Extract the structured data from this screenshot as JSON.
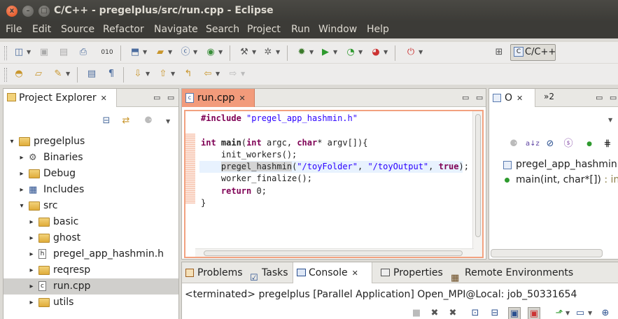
{
  "window": {
    "title": "C/C++ - pregelplus/src/run.cpp - Eclipse",
    "close_glyph": "x",
    "min_glyph": "–",
    "max_glyph": "□"
  },
  "menu": [
    "File",
    "Edit",
    "Source",
    "Refactor",
    "Navigate",
    "Search",
    "Project",
    "Run",
    "Window",
    "Help"
  ],
  "perspective": {
    "label": "C/C++"
  },
  "project_explorer": {
    "tab_label": "Project Explorer",
    "close": "✕",
    "items": [
      {
        "label": "pregelplus",
        "level": 0,
        "twisty": "▾",
        "icon": "project-icon"
      },
      {
        "label": "Binaries",
        "level": 1,
        "twisty": "▸",
        "icon": "binaries-icon"
      },
      {
        "label": "Debug",
        "level": 1,
        "twisty": "▸",
        "icon": "folder-icon"
      },
      {
        "label": "Includes",
        "level": 1,
        "twisty": "▸",
        "icon": "includes-icon"
      },
      {
        "label": "src",
        "level": 1,
        "twisty": "▾",
        "icon": "folder-icon"
      },
      {
        "label": "basic",
        "level": 2,
        "twisty": "▸",
        "icon": "folder-icon"
      },
      {
        "label": "ghost",
        "level": 2,
        "twisty": "▸",
        "icon": "folder-icon"
      },
      {
        "label": "pregel_app_hashmin.h",
        "level": 2,
        "twisty": "▸",
        "icon": "header-file-icon"
      },
      {
        "label": "reqresp",
        "level": 2,
        "twisty": "▸",
        "icon": "folder-icon"
      },
      {
        "label": "run.cpp",
        "level": 2,
        "twisty": "▸",
        "icon": "cpp-file-icon",
        "selected": true
      },
      {
        "label": "utils",
        "level": 2,
        "twisty": "▸",
        "icon": "folder-icon"
      }
    ]
  },
  "editor": {
    "tab_label": "run.cpp",
    "close": "✕",
    "code": {
      "include_kw": "#include",
      "include_str": "\"pregel_app_hashmin.h\"",
      "l3_int": "int",
      "l3_main": "main",
      "l3_int2": "int",
      "l3_argc": " argc, ",
      "l3_char": "char",
      "l3_rest": "* argv[]){",
      "l4": "    init_workers();",
      "l5_indent": "    ",
      "l5_fn": "pregel_hashmin",
      "l5_open": "(",
      "l5_s1": "\"/toyFolder\"",
      "l5_comma": ", ",
      "l5_s2": "\"/toyOutput\"",
      "l5_comma2": ", ",
      "l5_true": "true",
      "l5_end": ");",
      "l6": "    worker_finalize();",
      "l7_indent": "    ",
      "l7_ret": "return",
      "l7_rest": " 0;",
      "l8": "}"
    }
  },
  "outline": {
    "tab_label": "O",
    "close": "✕",
    "overflow": "»2",
    "items": [
      {
        "label": "pregel_app_hashmin.",
        "icon": "include-icon"
      },
      {
        "label": "main(int, char*[])",
        "ret": " : int",
        "icon": "function-icon"
      }
    ]
  },
  "bottom": {
    "tabs": [
      "Problems",
      "Tasks",
      "Console",
      "Properties",
      "Remote Environments"
    ],
    "close": "✕",
    "console_text": "<terminated> pregelplus [Parallel Application] Open_MPI@Local: job_50331654"
  },
  "minmax": "▭ ▭"
}
